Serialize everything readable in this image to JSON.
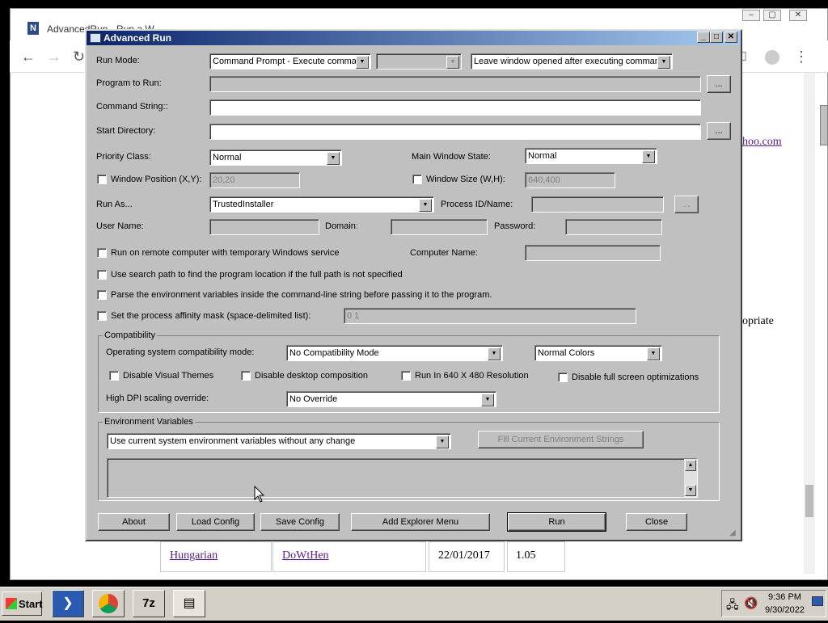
{
  "browser": {
    "tab_title": "AdvancedRun - Run a W...",
    "page_link_fragment": "hoo.com",
    "page_text_fragment": "opriate",
    "table_row": [
      "Hungarian",
      "DoWtHen",
      "22/01/2017",
      "1.05"
    ]
  },
  "dialog": {
    "title": "Advanced Run",
    "run_mode_label": "Run Mode:",
    "run_mode_value": "Command Prompt - Execute command",
    "run_mode_sub_value": "",
    "window_option_value": "Leave window opened after executing command",
    "program_label": "Program to Run:",
    "program_value": "",
    "browse_label": "...",
    "command_label": "Command String::",
    "command_value": "",
    "startdir_label": "Start Directory:",
    "startdir_value": "",
    "priority_label": "Priority Class:",
    "priority_value": "Normal",
    "mainwin_label": "Main Window State:",
    "mainwin_value": "Normal",
    "winpos_label": "Window Position (X,Y):",
    "winpos_value": "20,20",
    "winsize_label": "Window Size (W,H):",
    "winsize_value": "640,400",
    "runas_label": "Run As...",
    "runas_value": "TrustedInstaller",
    "pid_label": "Process ID/Name:",
    "pid_value": "",
    "username_label": "User Name:",
    "domain_label": "Domain:",
    "password_label": "Password:",
    "remote_label": "Run on remote computer with temporary Windows service",
    "computer_label": "Computer Name:",
    "searchpath_label": "Use search path to find the program location if the full path is not specified",
    "parseenv_label": "Parse the environment variables inside the command-line string before passing it to the program.",
    "affinity_label": "Set the process affinity mask (space-delimited list):",
    "affinity_value": "0 1",
    "compat_group": "Compatibility",
    "compat_os_label": "Operating system compatibility mode:",
    "compat_os_value": "No Compatibility Mode",
    "colors_value": "Normal Colors",
    "disable_themes": "Disable Visual Themes",
    "disable_desktop": "Disable desktop composition",
    "run640": "Run In 640 X 480 Resolution",
    "disable_fullscreen": "Disable full screen optimizations",
    "dpi_label": "High DPI scaling override:",
    "dpi_value": "No Override",
    "env_group": "Environment Variables",
    "env_value": "Use current system environment variables without any change",
    "fill_env_label": "Fill Current Environment Strings",
    "buttons": {
      "about": "About",
      "load": "Load Config",
      "save": "Save Config",
      "explorer": "Add Explorer Menu",
      "run": "Run",
      "close": "Close"
    }
  },
  "taskbar": {
    "start": "Start",
    "time": "9:36 PM",
    "date": "9/30/2022"
  }
}
